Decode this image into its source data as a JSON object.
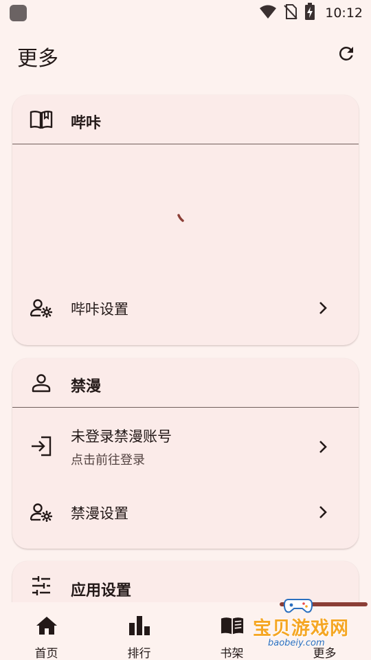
{
  "status_bar": {
    "time": "10:12",
    "icons": [
      "wifi-icon",
      "no-sim-icon",
      "battery-charging-icon"
    ]
  },
  "header": {
    "title": "更多",
    "refresh_icon": "refresh-icon"
  },
  "cards": {
    "picacg": {
      "title": "哔咔",
      "icon": "book-open-icon",
      "settings_label": "哔咔设置"
    },
    "jm": {
      "title": "禁漫",
      "icon": "person-icon",
      "account_label": "未登录禁漫账号",
      "account_sub": "点击前往登录",
      "settings_label": "禁漫设置"
    },
    "app": {
      "title": "应用设置",
      "icon": "tune-icon"
    }
  },
  "bottom_nav": {
    "items": [
      {
        "label": "首页",
        "icon": "home-icon"
      },
      {
        "label": "排行",
        "icon": "bar-chart-icon"
      },
      {
        "label": "书架",
        "icon": "book-icon"
      },
      {
        "label": "更多",
        "icon": "more-icon"
      }
    ],
    "selected_index": 3
  },
  "watermark": {
    "text": "宝贝游戏网",
    "url": "baobeiy.com"
  },
  "colors": {
    "background": "#FDF2EF",
    "card": "#FBEBE9",
    "accent": "#8B3E36",
    "text": "#231918"
  }
}
